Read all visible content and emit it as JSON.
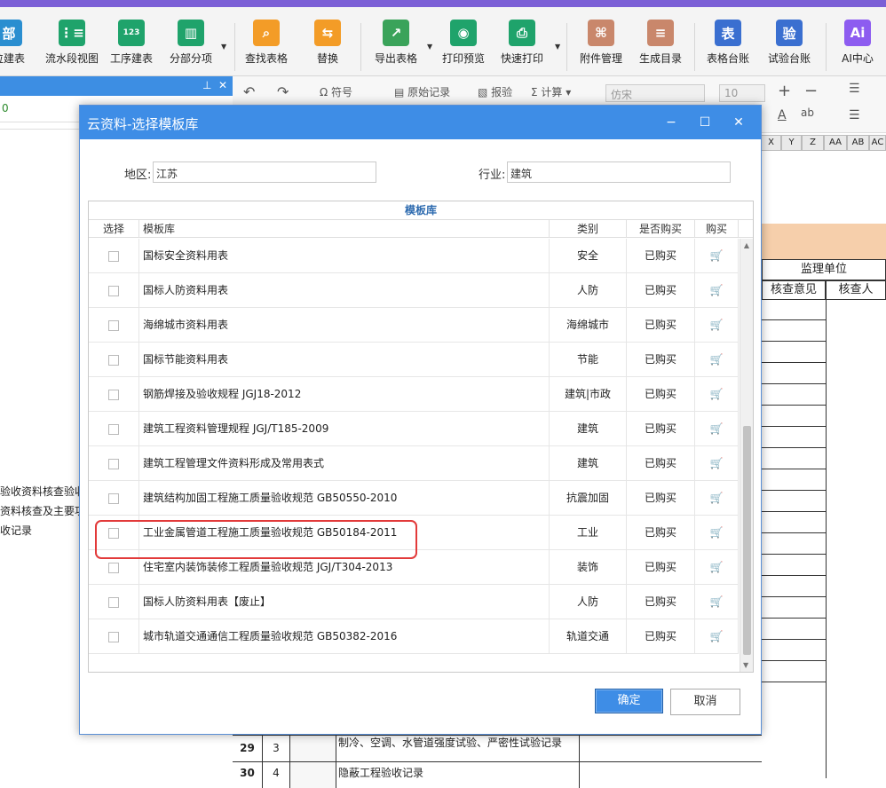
{
  "ribbon": {
    "items": [
      {
        "label": "位建表",
        "icon": "部",
        "color": "#2a8ed0"
      },
      {
        "label": "流水段视图",
        "icon": "⋮≡",
        "color": "#1fa36b"
      },
      {
        "label": "工序建表",
        "icon": "123",
        "color": "#1fa36b"
      },
      {
        "label": "分部分项",
        "icon": "▥",
        "color": "#1fa36b"
      },
      {
        "label": "查找表格",
        "icon": "⌕",
        "color": "#f39c27"
      },
      {
        "label": "替换",
        "icon": "⇆",
        "color": "#f39c27"
      },
      {
        "label": "导出表格",
        "icon": "↗",
        "color": "#3aa35a"
      },
      {
        "label": "打印预览",
        "icon": "◉",
        "color": "#1fa36b"
      },
      {
        "label": "快速打印",
        "icon": "⎙",
        "color": "#1fa36b"
      },
      {
        "label": "附件管理",
        "icon": "⌘",
        "color": "#c9876b"
      },
      {
        "label": "生成目录",
        "icon": "≡",
        "color": "#c9876b"
      },
      {
        "label": "表格台账",
        "icon": "表",
        "color": "#3a6fd0"
      },
      {
        "label": "试验台账",
        "icon": "验",
        "color": "#3a6fd0"
      },
      {
        "label": "AI中心",
        "icon": "Ai",
        "color": "#8d5cf0"
      }
    ]
  },
  "toolbar2": {
    "symbol": "符号",
    "original": "原始记录",
    "report": "报验",
    "calc": "计算",
    "font": "仿宋",
    "size": "10"
  },
  "left_panel": {
    "tab_value": "0",
    "lines": [
      "验收资料核查验收",
      "资料核查及主要功",
      "收记录"
    ]
  },
  "sheet": {
    "columns": [
      "X",
      "Y",
      "Z",
      "AA",
      "AB",
      "AC"
    ],
    "supervisor": "监理单位",
    "check_opinion": "核查意见",
    "checker": "核查人",
    "rows": [
      {
        "no": "29",
        "idx": "3",
        "text": "制冷、空调、水管道强度试验、严密性试验记录"
      },
      {
        "no": "30",
        "idx": "4",
        "text": "隐蔽工程验收记录"
      }
    ]
  },
  "dialog": {
    "title": "云资料-选择模板库",
    "region_label": "地区:",
    "region_value": "江苏",
    "industry_label": "行业:",
    "industry_value": "建筑",
    "grid_title": "模板库",
    "headers": {
      "select": "选择",
      "library": "模板库",
      "category": "类别",
      "purchased": "是否购买",
      "buy": "购买"
    },
    "rows": [
      {
        "name": "国标安全资料用表",
        "category": "安全",
        "status": "已购买"
      },
      {
        "name": "国标人防资料用表",
        "category": "人防",
        "status": "已购买"
      },
      {
        "name": "海绵城市资料用表",
        "category": "海绵城市",
        "status": "已购买"
      },
      {
        "name": "国标节能资料用表",
        "category": "节能",
        "status": "已购买"
      },
      {
        "name": "钢筋焊接及验收规程 JGJ18-2012",
        "category": "建筑|市政",
        "status": "已购买"
      },
      {
        "name": "建筑工程资料管理规程 JGJ/T185-2009",
        "category": "建筑",
        "status": "已购买"
      },
      {
        "name": "建筑工程管理文件资料形成及常用表式",
        "category": "建筑",
        "status": "已购买"
      },
      {
        "name": "建筑结构加固工程施工质量验收规范 GB50550-2010",
        "category": "抗震加固",
        "status": "已购买"
      },
      {
        "name": "工业金属管道工程施工质量验收规范 GB50184-2011",
        "category": "工业",
        "status": "已购买"
      },
      {
        "name": "住宅室内装饰装修工程质量验收规范 JGJ/T304-2013",
        "category": "装饰",
        "status": "已购买"
      },
      {
        "name": "国标人防资料用表【废止】",
        "category": "人防",
        "status": "已购买"
      },
      {
        "name": "城市轨道交通通信工程质量验收规范 GB50382-2016",
        "category": "轨道交通",
        "status": "已购买"
      }
    ],
    "ok_label": "确定",
    "cancel_label": "取消"
  }
}
